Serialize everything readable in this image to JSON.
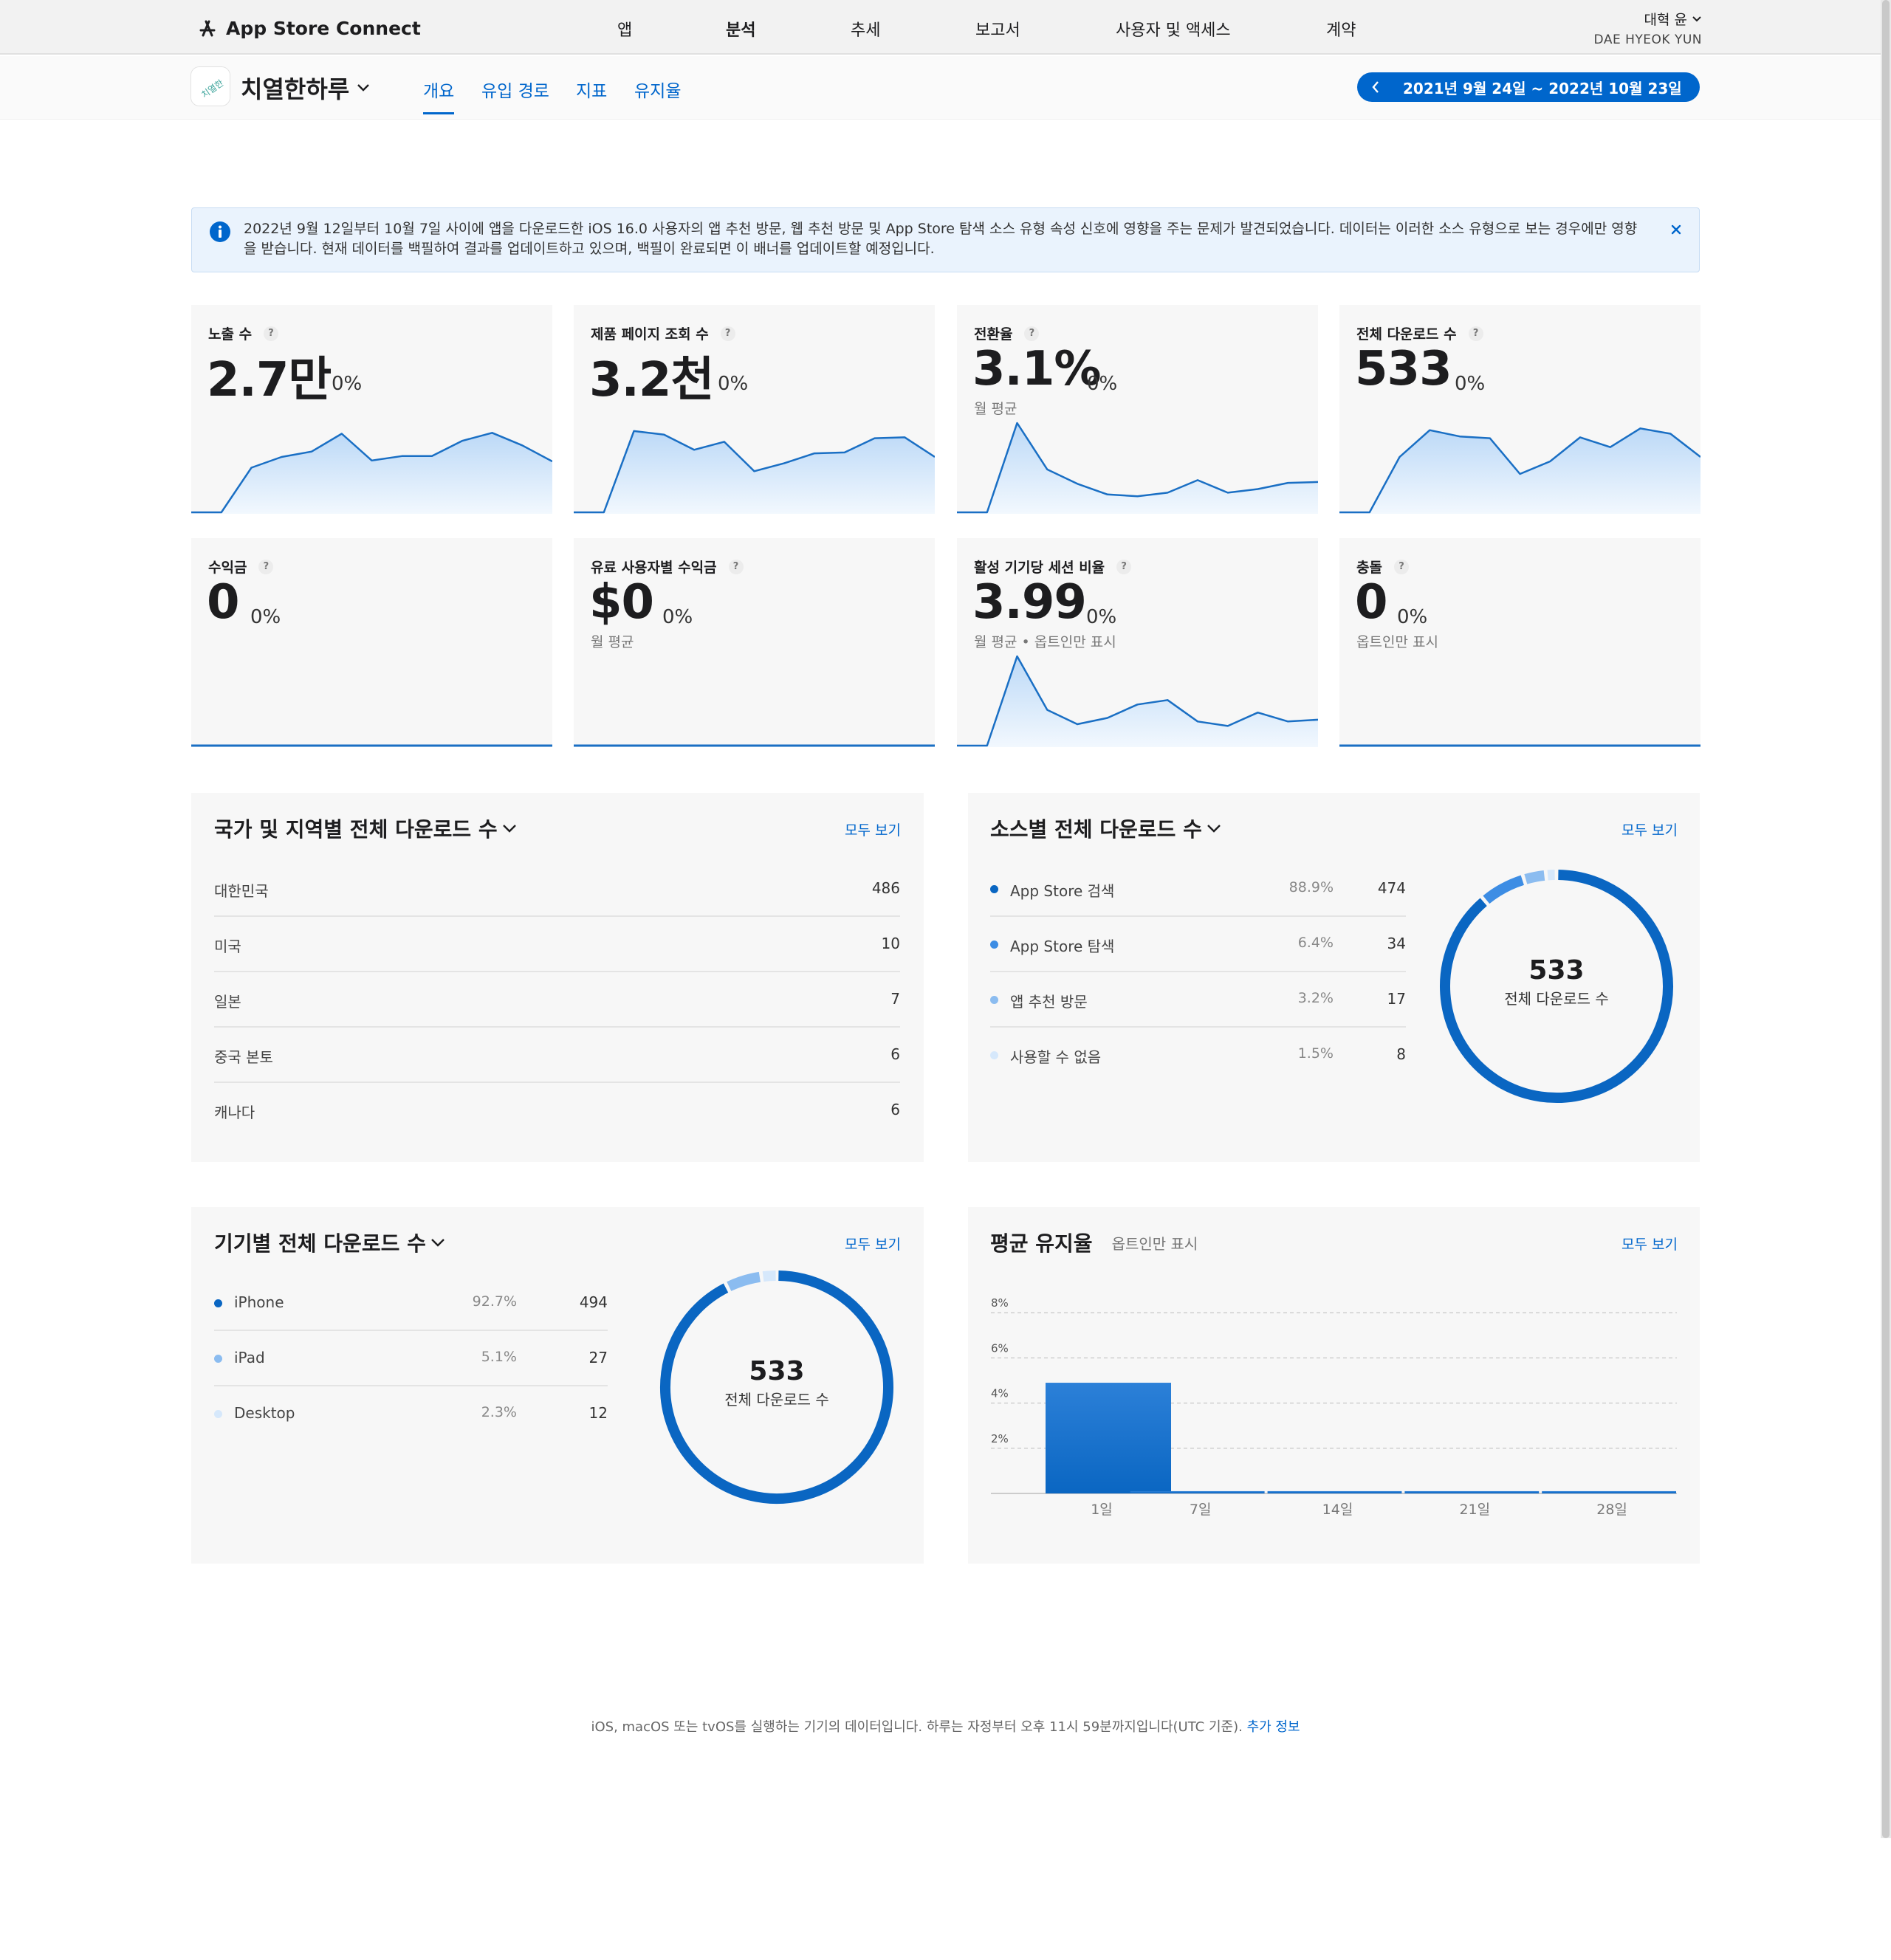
{
  "header": {
    "brand": "App Store Connect",
    "nav": [
      "앱",
      "분석",
      "추세",
      "보고서",
      "사용자 및 액세스",
      "계약"
    ],
    "active_nav": "분석",
    "user_name": "대혁 윤",
    "user_org": "DAE HYEOK YUN"
  },
  "app": {
    "name": "치열한하루",
    "icon_text": "치열한",
    "tabs": [
      "개요",
      "유입 경로",
      "지표",
      "유지율"
    ],
    "active_tab": "개요",
    "date_range": "2021년 9월 24일 ~ 2022년 10월 23일"
  },
  "banner": {
    "text": "2022년 9월 12일부터 10월 7일 사이에 앱을 다운로드한 iOS 16.0 사용자의 앱 추천 방문, 웹 추천 방문 및 App Store 탐색 소스 유형 속성 신호에 영향을 주는 문제가 발견되었습니다. 데이터는 이러한 소스 유형으로 보는 경우에만 영향을 받습니다. 현재 데이터를 백필하여 결과를 업데이트하고 있으며, 백필이 완료되면 이 배너를 업데이트할 예정입니다."
  },
  "metrics": [
    {
      "title": "노출 수",
      "value": "2.7만",
      "change": "0%",
      "sub": "",
      "trend": [
        0,
        0,
        0.5,
        0.62,
        0.68,
        0.88,
        0.58,
        0.63,
        0.63,
        0.8,
        0.89,
        0.75,
        0.57
      ]
    },
    {
      "title": "제품 페이지 조회 수",
      "value": "3.2천",
      "change": "0%",
      "sub": "",
      "trend": [
        0,
        0,
        0.91,
        0.87,
        0.7,
        0.79,
        0.46,
        0.55,
        0.66,
        0.67,
        0.83,
        0.84,
        0.62
      ]
    },
    {
      "title": "전환율",
      "value": "3.1%",
      "change": "0%",
      "sub": "월 평균",
      "trend": [
        0,
        0,
        1.0,
        0.48,
        0.32,
        0.2,
        0.18,
        0.22,
        0.36,
        0.22,
        0.26,
        0.33,
        0.34
      ]
    },
    {
      "title": "전체 다운로드 수",
      "value": "533",
      "change": "0%",
      "sub": "",
      "trend": [
        0,
        0,
        0.62,
        0.92,
        0.85,
        0.83,
        0.43,
        0.57,
        0.84,
        0.73,
        0.94,
        0.88,
        0.62
      ]
    },
    {
      "title": "수익금",
      "value": "0",
      "change": "0%",
      "sub": "",
      "trend": []
    },
    {
      "title": "유료 사용자별 수익금",
      "value": "$0",
      "change": "0%",
      "sub": "월 평균",
      "trend": []
    },
    {
      "title": "활성 기기당 세션 비율",
      "value": "3.99",
      "change": "0%",
      "sub": "월 평균 • 옵트인만 표시",
      "trend": [
        0,
        0,
        1.0,
        0.4,
        0.24,
        0.31,
        0.46,
        0.51,
        0.27,
        0.22,
        0.37,
        0.27,
        0.29
      ]
    },
    {
      "title": "충돌",
      "value": "0",
      "change": "0%",
      "sub": "옵트인만 표시",
      "trend": []
    }
  ],
  "country_panel": {
    "title": "국가 및 지역별 전체 다운로드 수",
    "see_all": "모두 보기",
    "rows": [
      {
        "label": "대한민국",
        "value": "486"
      },
      {
        "label": "미국",
        "value": "10"
      },
      {
        "label": "일본",
        "value": "7"
      },
      {
        "label": "중국 본토",
        "value": "6"
      },
      {
        "label": "캐나다",
        "value": "6"
      }
    ]
  },
  "source_panel": {
    "title": "소스별 전체 다운로드 수",
    "see_all": "모두 보기",
    "rows": [
      {
        "label": "App Store 검색",
        "pct": "88.9%",
        "value": "474",
        "color": "#0a66c2",
        "share": 0.889
      },
      {
        "label": "App Store 탐색",
        "pct": "6.4%",
        "value": "34",
        "color": "#3d8de4",
        "share": 0.064
      },
      {
        "label": "앱 추천 방문",
        "pct": "3.2%",
        "value": "17",
        "color": "#8bbcf0",
        "share": 0.032
      },
      {
        "label": "사용할 수 없음",
        "pct": "1.5%",
        "value": "8",
        "color": "#d6e8fb",
        "share": 0.015
      }
    ],
    "total": "533",
    "total_label": "전체 다운로드 수"
  },
  "device_panel": {
    "title": "기기별 전체 다운로드 수",
    "see_all": "모두 보기",
    "rows": [
      {
        "label": "iPhone",
        "pct": "92.7%",
        "value": "494",
        "color": "#0a66c2",
        "share": 0.927
      },
      {
        "label": "iPad",
        "pct": "5.1%",
        "value": "27",
        "color": "#8bbcf0",
        "share": 0.051
      },
      {
        "label": "Desktop",
        "pct": "2.3%",
        "value": "12",
        "color": "#d6e8fb",
        "share": 0.023
      }
    ],
    "total": "533",
    "total_label": "전체 다운로드 수"
  },
  "retention_panel": {
    "title": "평균 유지율",
    "note": "옵트인만 표시",
    "see_all": "모두 보기"
  },
  "chart_data": {
    "type": "bar",
    "categories": [
      "1일",
      "7일",
      "14일",
      "21일",
      "28일"
    ],
    "values": [
      4.9,
      0.1,
      0.1,
      0.1,
      0.1
    ],
    "y_ticks": [
      "8%",
      "6%",
      "4%",
      "2%"
    ],
    "ylim": [
      0,
      8.5
    ],
    "grid": true
  },
  "footer": {
    "text": "iOS, macOS 또는 tvOS를 실행하는 기기의 데이터입니다. 하루는 자정부터 오후 11시 59분까지입니다(UTC 기준).",
    "link": "추가 정보"
  }
}
